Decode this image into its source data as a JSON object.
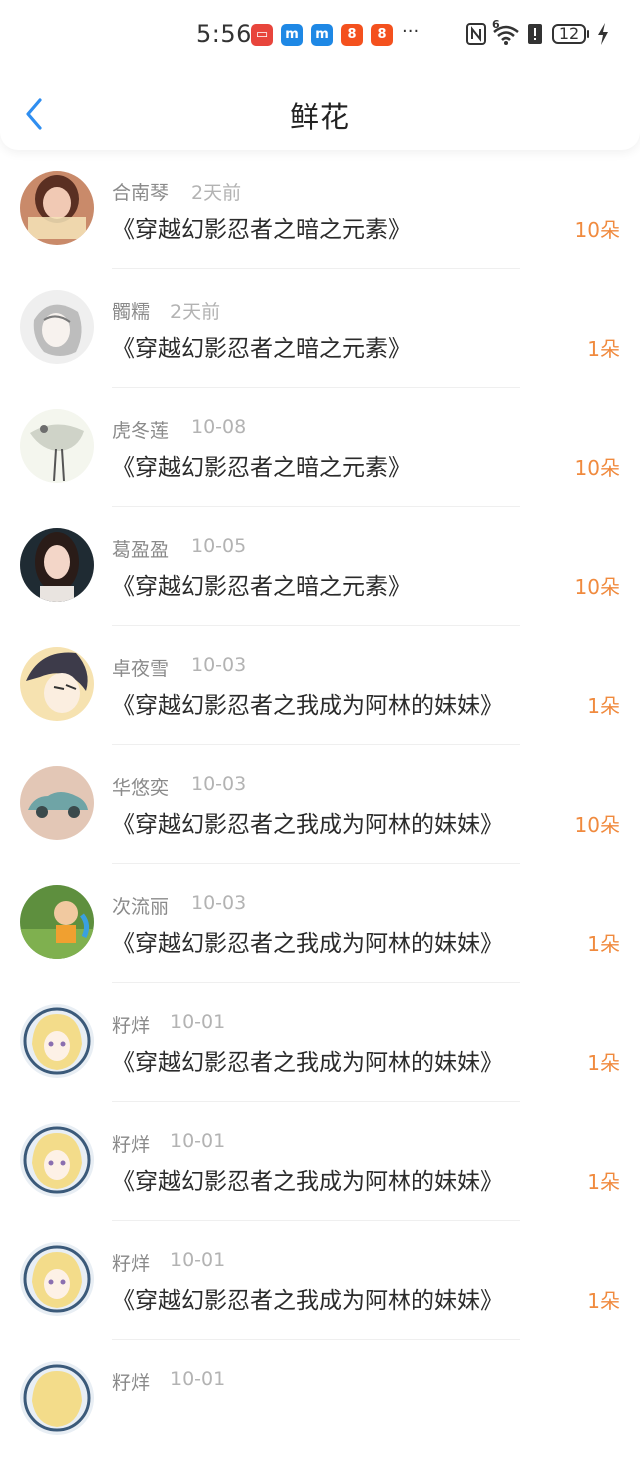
{
  "status_bar": {
    "time": "5:56",
    "network_label": "6",
    "battery": "12"
  },
  "header": {
    "title": "鲜花"
  },
  "entries": [
    {
      "name": "合南琴",
      "date": "2天前",
      "book": "《穿越幻影忍者之暗之元素》",
      "flowers": "10朵"
    },
    {
      "name": "髑糯",
      "date": "2天前",
      "book": "《穿越幻影忍者之暗之元素》",
      "flowers": "1朵"
    },
    {
      "name": "虎冬莲",
      "date": "10-08",
      "book": "《穿越幻影忍者之暗之元素》",
      "flowers": "10朵"
    },
    {
      "name": "葛盈盈",
      "date": "10-05",
      "book": "《穿越幻影忍者之暗之元素》",
      "flowers": "10朵"
    },
    {
      "name": "卓夜雪",
      "date": "10-03",
      "book": "《穿越幻影忍者之我成为阿林的妹妹》",
      "flowers": "1朵"
    },
    {
      "name": "华悠奕",
      "date": "10-03",
      "book": "《穿越幻影忍者之我成为阿林的妹妹》",
      "flowers": "10朵"
    },
    {
      "name": "次流丽",
      "date": "10-03",
      "book": "《穿越幻影忍者之我成为阿林的妹妹》",
      "flowers": "1朵"
    },
    {
      "name": "籽烊",
      "date": "10-01",
      "book": "《穿越幻影忍者之我成为阿林的妹妹》",
      "flowers": "1朵"
    },
    {
      "name": "籽烊",
      "date": "10-01",
      "book": "《穿越幻影忍者之我成为阿林的妹妹》",
      "flowers": "1朵"
    },
    {
      "name": "籽烊",
      "date": "10-01",
      "book": "《穿越幻影忍者之我成为阿林的妹妹》",
      "flowers": "1朵"
    },
    {
      "name": "籽烊",
      "date": "10-01",
      "book": "",
      "flowers": ""
    }
  ],
  "colors": {
    "accent_blue": "#2f8ef0",
    "flower_orange": "#f08a3e"
  }
}
